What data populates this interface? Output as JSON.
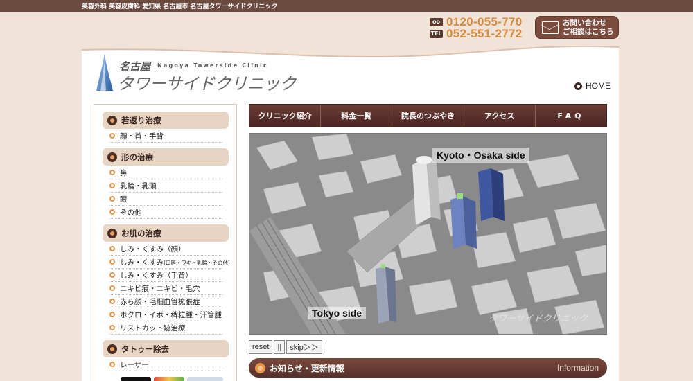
{
  "topbar": {
    "text": "美容外科 美容皮膚科 愛知県 名古屋市 名古屋タワーサイドクリニック"
  },
  "contact": {
    "free_icon": "oo",
    "free_number": "0120-055-770",
    "tel_icon": "TEL",
    "tel_number": "052-551-2772",
    "inquiry_line1": "お問い合わせ",
    "inquiry_line2": "ご相談はこちら",
    "inquiry_icon": "envelope-icon"
  },
  "logo": {
    "small": "名古屋",
    "english": "Nagoya Towerside Clinic",
    "main": "タワーサイドクリニック"
  },
  "home_link": "HOME",
  "sidebar": {
    "sections": [
      {
        "title": "若返り治療",
        "items": [
          {
            "label": "顔・首・手背"
          }
        ]
      },
      {
        "title": "形の治療",
        "items": [
          {
            "label": "鼻"
          },
          {
            "label": "乳輪・乳頭"
          },
          {
            "label": "眼"
          },
          {
            "label": "その他"
          }
        ]
      },
      {
        "title": "お肌の治療",
        "items": [
          {
            "label": "しみ・くすみ（顔）"
          },
          {
            "label": "しみ・くすみ",
            "small": "(口唇・ワキ・乳輪・その他)"
          },
          {
            "label": "しみ・くすみ（手背）"
          },
          {
            "label": "ニキビ痕・ニキビ・毛穴"
          },
          {
            "label": "赤ら顔・毛細血管拡張症"
          },
          {
            "label": "ホクロ・イボ・稗粒腫・汗管腫"
          },
          {
            "label": "リストカット跡治療"
          }
        ]
      },
      {
        "title": "タトゥー除去",
        "items": [
          {
            "label": "レーザー"
          }
        ]
      }
    ]
  },
  "nav": [
    "クリニック紹介",
    "料金一覧",
    "院長のつぶやき",
    "アクセス",
    "FAQ"
  ],
  "video": {
    "label_top": "Kyoto・Osaka side",
    "label_bottom": "Tokyo side",
    "watermark": "タワーサイドクリニック"
  },
  "controls": {
    "reset": "reset",
    "pause": "||",
    "skip": "skip＞＞"
  },
  "news": {
    "title": "お知らせ・更新情報",
    "english": "Information"
  },
  "colors": {
    "brand_brown": "#6b4a40",
    "accent_orange": "#e8934a",
    "phone_orange": "#d68a3c",
    "panel_beige": "#f2e3d8"
  }
}
